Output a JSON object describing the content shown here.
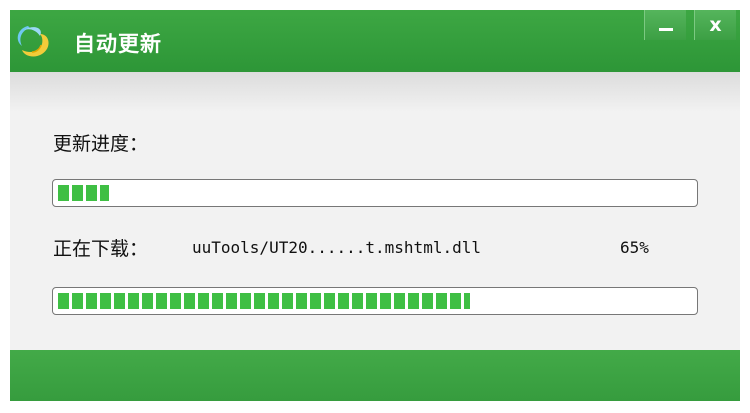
{
  "window": {
    "title": "自动更新",
    "minimize_label": "—",
    "close_label": "x"
  },
  "overall": {
    "label": "更新进度：",
    "progress": 0.08
  },
  "file": {
    "label": "正在下载：",
    "name": "uuTools/UT20......t.mshtml.dll",
    "percent_text": "65%",
    "progress": 0.65
  },
  "colors": {
    "title_bar": "#34a03c",
    "progress_fill": "#3fbf44",
    "content_bg": "#f2f2f2"
  },
  "icons": {
    "app_logo": "uutools-logo-icon",
    "minimize": "minimize-icon",
    "close": "close-icon"
  }
}
